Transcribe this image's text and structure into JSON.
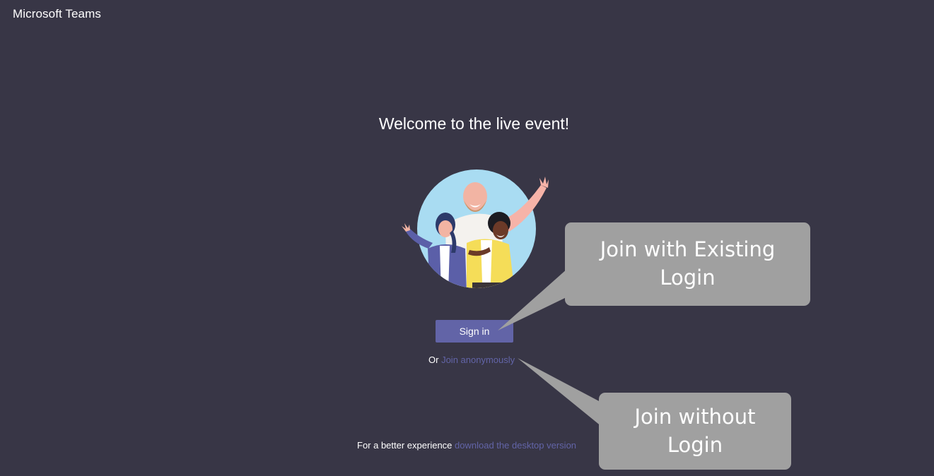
{
  "app": {
    "title": "Microsoft Teams"
  },
  "main": {
    "welcome": "Welcome to the live event!",
    "signin_label": "Sign in",
    "anon_prefix": "Or",
    "anon_link": "Join anonymously",
    "footer_prefix": "For a better experience",
    "footer_link": "download the desktop version"
  },
  "callouts": {
    "existing_login": {
      "line1": "Join with Existing",
      "line2": "Login"
    },
    "without_login": {
      "line1": "Join without",
      "line2": "Login"
    }
  },
  "colors": {
    "background": "#383646",
    "accent": "#6264a7",
    "callout": "#a0a0a0"
  },
  "icons": {
    "illustration": "people-waving-illustration"
  }
}
